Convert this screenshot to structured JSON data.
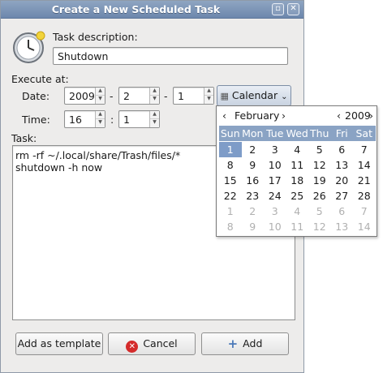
{
  "window": {
    "title": "Create a New Scheduled Task"
  },
  "form": {
    "description_label": "Task description:",
    "description_value": "Shutdown",
    "execute_label": "Execute at:",
    "date_label": "Date:",
    "year": "2009",
    "month": "2",
    "day": "1",
    "date_sep1": "-",
    "date_sep2": "-",
    "calendar_button": "Calendar",
    "time_label": "Time:",
    "hour": "16",
    "minute": "1",
    "time_sep": ":",
    "task_label": "Task:",
    "task_lines": [
      "rm -rf ~/.local/share/Trash/files/*",
      "shutdown -h now"
    ]
  },
  "buttons": {
    "template": "Add as template",
    "cancel": "Cancel",
    "add": "Add"
  },
  "calendar": {
    "month": "February",
    "year": "2009",
    "prev": "‹",
    "next": "›",
    "weekdays": [
      "Sun",
      "Mon",
      "Tue",
      "Wed",
      "Thu",
      "Fri",
      "Sat"
    ],
    "weeks": [
      [
        "1",
        "2",
        "3",
        "4",
        "5",
        "6",
        "7"
      ],
      [
        "8",
        "9",
        "10",
        "11",
        "12",
        "13",
        "14"
      ],
      [
        "15",
        "16",
        "17",
        "18",
        "19",
        "20",
        "21"
      ],
      [
        "22",
        "23",
        "24",
        "25",
        "26",
        "27",
        "28"
      ],
      [
        "1",
        "2",
        "3",
        "4",
        "5",
        "6",
        "7"
      ],
      [
        "8",
        "9",
        "10",
        "11",
        "12",
        "13",
        "14"
      ]
    ],
    "selected_day": "1"
  },
  "colors": {
    "titlebar": "#6c87ad",
    "calendar_header": "#8aa3c4",
    "selected": "#7e9cc8",
    "cancel_icon": "#d42b2b",
    "add_icon": "#4a78b8"
  }
}
